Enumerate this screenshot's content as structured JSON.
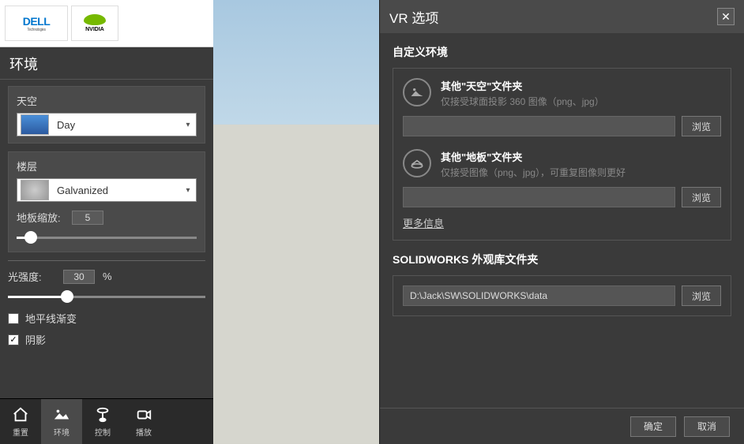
{
  "logos": {
    "dell": "DELL",
    "dell_sub": "Technologies",
    "nvidia": "NVIDIA"
  },
  "panel": {
    "title": "环境",
    "sky": {
      "label": "天空",
      "value": "Day"
    },
    "floor": {
      "label": "楼层",
      "value": "Galvanized"
    },
    "floor_scale": {
      "label": "地板缩放:",
      "value": "5",
      "percent": 8
    },
    "light": {
      "label": "光强度:",
      "value": "30",
      "unit": "%",
      "percent": 30
    },
    "horizon_gradient": {
      "label": "地平线渐变",
      "checked": false
    },
    "shadow": {
      "label": "阴影",
      "checked": true
    }
  },
  "nav": {
    "reset": "重置",
    "env": "环境",
    "control": "控制",
    "play": "播放"
  },
  "dialog": {
    "title": "VR 选项",
    "custom_env": "自定义环境",
    "sky_folder": {
      "title": "其他\"天空\"文件夹",
      "sub": "仅接受球面投影 360 图像（png、jpg）"
    },
    "floor_folder": {
      "title": "其他\"地板\"文件夹",
      "sub": "仅接受图像（png、jpg），可重复图像则更好"
    },
    "browse": "浏览",
    "more_info": "更多信息",
    "sw_lib": "SOLIDWORKS 外观库文件夹",
    "sw_path": "D:\\Jack\\SW\\SOLIDWORKS\\data",
    "ok": "确定",
    "cancel": "取消"
  }
}
